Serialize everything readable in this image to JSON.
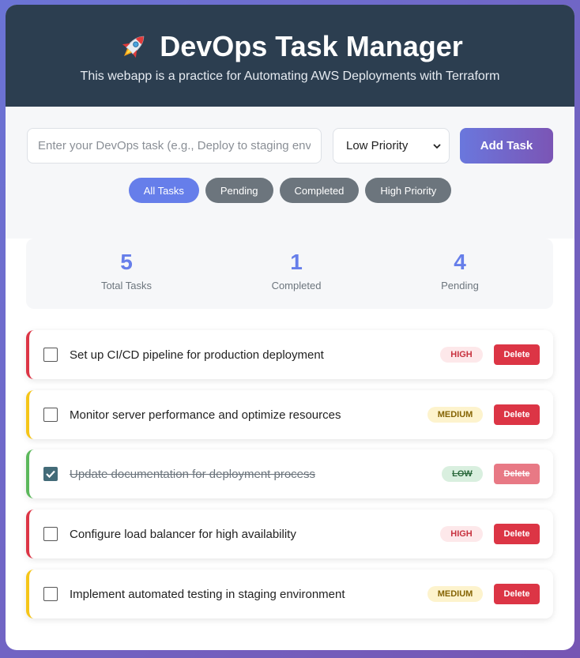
{
  "header": {
    "title": "DevOps Task Manager",
    "subtitle": "This webapp is a practice for Automating AWS Deployments with Terraform",
    "icon": "rocket-icon"
  },
  "form": {
    "task_placeholder": "Enter your DevOps task (e.g., Deploy to staging envirc",
    "task_value": "",
    "priority_selected": "Low Priority",
    "add_label": "Add Task"
  },
  "filters": [
    {
      "label": "All Tasks",
      "active": true
    },
    {
      "label": "Pending",
      "active": false
    },
    {
      "label": "Completed",
      "active": false
    },
    {
      "label": "High Priority",
      "active": false
    }
  ],
  "stats": [
    {
      "value": "5",
      "label": "Total Tasks"
    },
    {
      "value": "1",
      "label": "Completed"
    },
    {
      "value": "4",
      "label": "Pending"
    }
  ],
  "tasks": [
    {
      "text": "Set up CI/CD pipeline for production deployment",
      "priority": "HIGH",
      "completed": false,
      "delete_label": "Delete"
    },
    {
      "text": "Monitor server performance and optimize resources",
      "priority": "MEDIUM",
      "completed": false,
      "delete_label": "Delete"
    },
    {
      "text": "Update documentation for deployment process",
      "priority": "LOW",
      "completed": true,
      "delete_label": "Delete"
    },
    {
      "text": "Configure load balancer for high availability",
      "priority": "HIGH",
      "completed": false,
      "delete_label": "Delete"
    },
    {
      "text": "Implement automated testing in staging environment",
      "priority": "MEDIUM",
      "completed": false,
      "delete_label": "Delete"
    }
  ],
  "colors": {
    "header_bg": "#2c3e50",
    "accent": "#667eea",
    "danger": "#dc3545",
    "medium": "#f5c518",
    "low": "#5cb85c"
  }
}
